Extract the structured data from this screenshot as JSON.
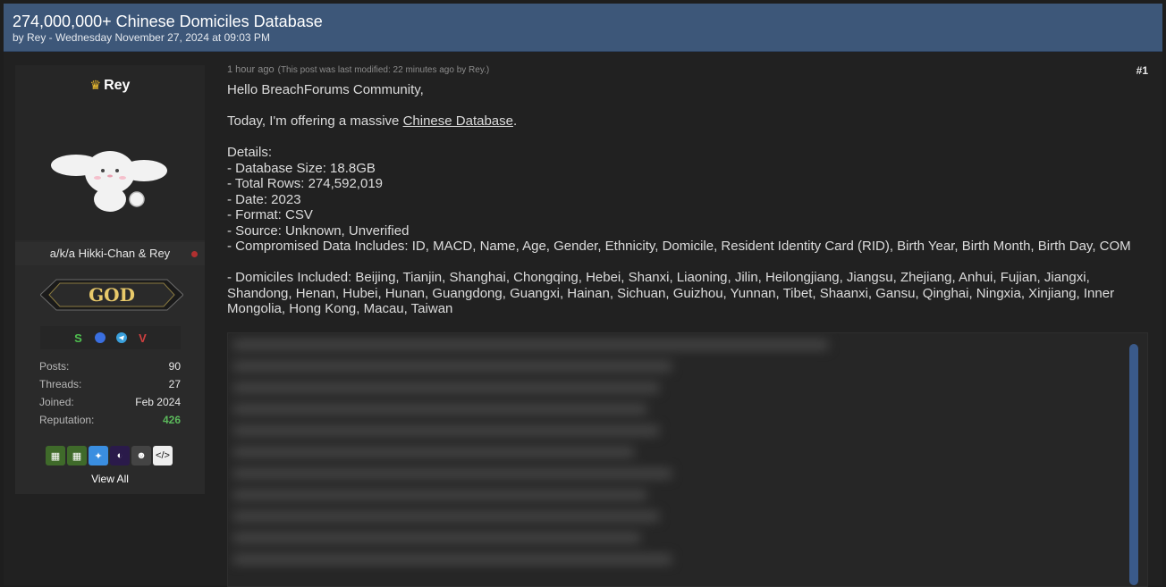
{
  "thread": {
    "title": "274,000,000+ Chinese Domiciles Database",
    "byline": "by Rey - Wednesday November 27, 2024 at 09:03 PM"
  },
  "author": {
    "name": "Rey",
    "crown_icon": "crown-icon",
    "alias": "a/k/a Hikki-Chan & Rey",
    "rank": "GOD",
    "contacts": [
      "session-icon",
      "signal-icon",
      "telegram-icon",
      "v-icon"
    ],
    "stats": [
      {
        "label": "Posts:",
        "value": "90"
      },
      {
        "label": "Threads:",
        "value": "27"
      },
      {
        "label": "Joined:",
        "value": "Feb 2024"
      },
      {
        "label": "Reputation:",
        "value": "426"
      }
    ],
    "view_all": "View All"
  },
  "post": {
    "time": "1 hour ago",
    "modified": "(This post was last modified: 22 minutes ago by Rey.)",
    "number": "#1",
    "greeting": "Hello BreachForums Community,",
    "offer_prefix": "Today, I'm offering a massive ",
    "offer_link": "Chinese Database",
    "offer_suffix": ".",
    "details_heading": "Details:",
    "details": [
      "- Database Size: 18.8GB",
      "- Total Rows: 274,592,019",
      "- Date: 2023",
      "- Format: CSV",
      "- Source: Unknown, Unverified",
      "- Compromised Data Includes: ID, MACD, Name, Age, Gender, Ethnicity, Domicile, Resident Identity Card (RID), Birth Year, Birth Month, Birth Day, COM"
    ],
    "domiciles": "- Domiciles Included: Beijing, Tianjin, Shanghai, Chongqing, Hebei, Shanxi, Liaoning, Jilin, Heilongjiang, Jiangsu, Zhejiang, Anhui, Fujian, Jiangxi, Shandong, Henan, Hubei, Hunan, Guangdong, Guangxi, Hainan, Sichuan, Guizhou, Yunnan, Tibet, Shaanxi, Gansu, Qinghai, Ningxia, Xinjiang, Inner Mongolia, Hong Kong, Macau, Taiwan"
  },
  "colors": {
    "header_bg": "#3d5779",
    "page_bg": "#212121",
    "reputation": "#5bb85b",
    "crown": "#f0c030"
  }
}
